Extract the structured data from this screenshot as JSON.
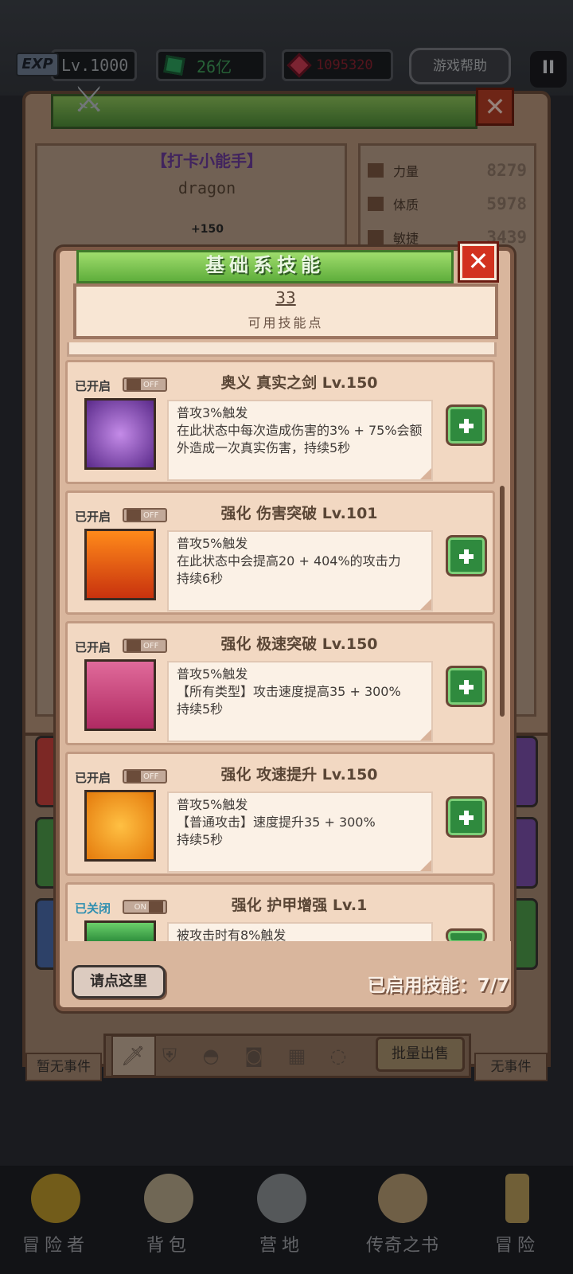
{
  "hud": {
    "exp_badge": "EXP",
    "level": "Lv.1000",
    "gems": "26亿",
    "rubies": "1095320",
    "help": "游戏帮助",
    "pause": "II"
  },
  "character": {
    "title": "【打卡小能手】",
    "name": "dragon",
    "bonus": "+150",
    "stats": [
      {
        "label": "力量",
        "value": "8279"
      },
      {
        "label": "体质",
        "value": "5978"
      },
      {
        "label": "敏捷",
        "value": "3439"
      }
    ]
  },
  "dialog": {
    "title": "基础系技能",
    "points": "33",
    "points_label": "可用技能点",
    "skills": [
      {
        "status": "已开启",
        "toggle": "OFF",
        "name": "奥义 真实之剑 Lv.150",
        "desc": "普攻3%触发\n在此状态中每次造成伤害的3% + 75%会额外造成一次真实伤害，持续5秒",
        "icon": "sword-icon",
        "color": "#7a3fb0"
      },
      {
        "status": "已开启",
        "toggle": "OFF",
        "name": "强化 伤害突破 Lv.101",
        "desc": "普攻5%触发\n在此状态中会提高20 + 404%的攻击力\n持续6秒",
        "icon": "fist-sword-icon",
        "color": "#e8531a"
      },
      {
        "status": "已开启",
        "toggle": "OFF",
        "name": "强化 极速突破 Lv.150",
        "desc": "普攻5%触发\n【所有类型】攻击速度提高35 + 300%\n持续5秒",
        "icon": "boot-icon",
        "color": "#d24a7e"
      },
      {
        "status": "已开启",
        "toggle": "OFF",
        "name": "强化 攻速提升 Lv.150",
        "desc": "普攻5%触发\n【普通攻击】速度提升35 + 300%\n持续5秒",
        "icon": "boot-icon",
        "color": "#f09a1a"
      },
      {
        "status": "已关闭",
        "toggle": "ON",
        "name": "强化 护甲增强 Lv.1",
        "desc": "被攻击时有8%触发",
        "icon": "armor-icon",
        "color": "#3ea64a"
      }
    ],
    "click_here": "请点这里",
    "enabled": "已启用技能：7/7"
  },
  "inventory": {
    "event_left": "暂无事件",
    "event_right": "无事件",
    "batch_sell": "批量出售"
  },
  "nav": [
    {
      "label": "冒险者",
      "icon": "helmet-icon"
    },
    {
      "label": "背包",
      "icon": "bag-icon"
    },
    {
      "label": "营地",
      "icon": "tent-icon"
    },
    {
      "label": "传奇之书",
      "icon": "book-icon"
    },
    {
      "label": "冒险",
      "icon": "sword-icon"
    }
  ]
}
